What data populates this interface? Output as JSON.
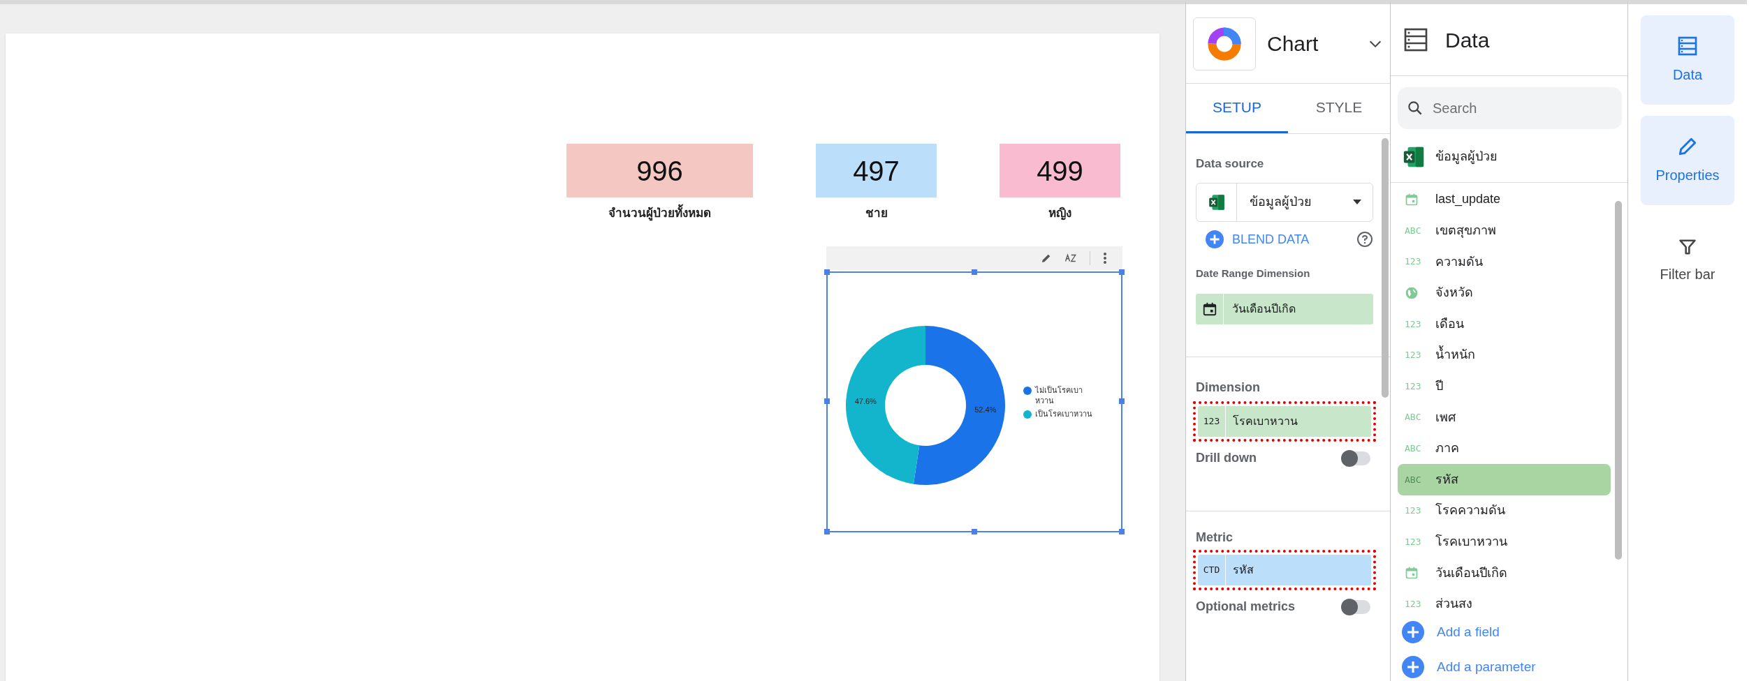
{
  "scorecards": [
    {
      "value": "996",
      "label": "จำนวนผู้ป่วยทั้งหมด",
      "color": "#f4c7c3"
    },
    {
      "value": "497",
      "label": "ชาย",
      "color": "#bbdefb"
    },
    {
      "value": "499",
      "label": "หญิง",
      "color": "#f8bbd0"
    }
  ],
  "chart": {
    "selected": true,
    "chart_data": {
      "type": "donut",
      "categories": [
        "ไม่เป็นโรคเบาหวาน",
        "เป็นโรคเบาหวาน"
      ],
      "values": [
        52.4,
        47.6
      ],
      "value_labels": [
        "52.4%",
        "47.6%"
      ],
      "colors": [
        "#1a73e8",
        "#12b5cb"
      ],
      "legend": "right"
    }
  },
  "setup_panel": {
    "title": "Chart",
    "tabs": [
      {
        "label": "SETUP",
        "selected": true
      },
      {
        "label": "STYLE",
        "selected": false
      }
    ],
    "data_source_label": "Data source",
    "data_source": "ข้อมูลผู้ป่วย",
    "blend_button": "BLEND DATA",
    "date_range_label": "Date Range Dimension",
    "date_range_field": "วันเดือนปีเกิด",
    "dimension_label": "Dimension",
    "dimension": {
      "badge": "123",
      "name": "โรคเบาหวาน",
      "highlighted": true
    },
    "drill_down": {
      "label": "Drill down",
      "on": false
    },
    "metric_label": "Metric",
    "metric": {
      "badge": "CTD",
      "name": "รหัส",
      "highlighted": true
    },
    "optional_metrics": {
      "label": "Optional metrics",
      "on": false
    }
  },
  "data_panel": {
    "title": "Data",
    "search_placeholder": "Search",
    "source": "ข้อมูลผู้ป่วย",
    "fields": [
      {
        "kind": "date",
        "name": "last_update",
        "selected": false
      },
      {
        "kind": "text",
        "badge": "ABC",
        "name": "เขตสุขภาพ",
        "selected": false
      },
      {
        "kind": "number",
        "badge": "123",
        "name": "ความดัน",
        "selected": false
      },
      {
        "kind": "geo",
        "name": "จังหวัด",
        "selected": false
      },
      {
        "kind": "number",
        "badge": "123",
        "name": "เดือน",
        "selected": false
      },
      {
        "kind": "number",
        "badge": "123",
        "name": "น้ำหนัก",
        "selected": false
      },
      {
        "kind": "number",
        "badge": "123",
        "name": "ปี",
        "selected": false
      },
      {
        "kind": "text",
        "badge": "ABC",
        "name": "เพศ",
        "selected": false
      },
      {
        "kind": "text",
        "badge": "ABC",
        "name": "ภาค",
        "selected": false
      },
      {
        "kind": "text",
        "badge": "ABC",
        "name": "รหัส",
        "selected": true
      },
      {
        "kind": "number",
        "badge": "123",
        "name": "โรคความดัน",
        "selected": false
      },
      {
        "kind": "number",
        "badge": "123",
        "name": "โรคเบาหวาน",
        "selected": false
      },
      {
        "kind": "date",
        "name": "วันเดือนปีเกิด",
        "selected": false
      },
      {
        "kind": "number",
        "badge": "123",
        "name": "ส่วนสง",
        "selected": false
      }
    ],
    "actions": [
      "Add a field",
      "Add a parameter"
    ]
  },
  "rail": [
    {
      "kind": "data",
      "label": "Data",
      "active": true
    },
    {
      "kind": "properties",
      "label": "Properties",
      "active": true
    },
    {
      "kind": "filter",
      "label": "Filter bar",
      "active": false
    }
  ]
}
